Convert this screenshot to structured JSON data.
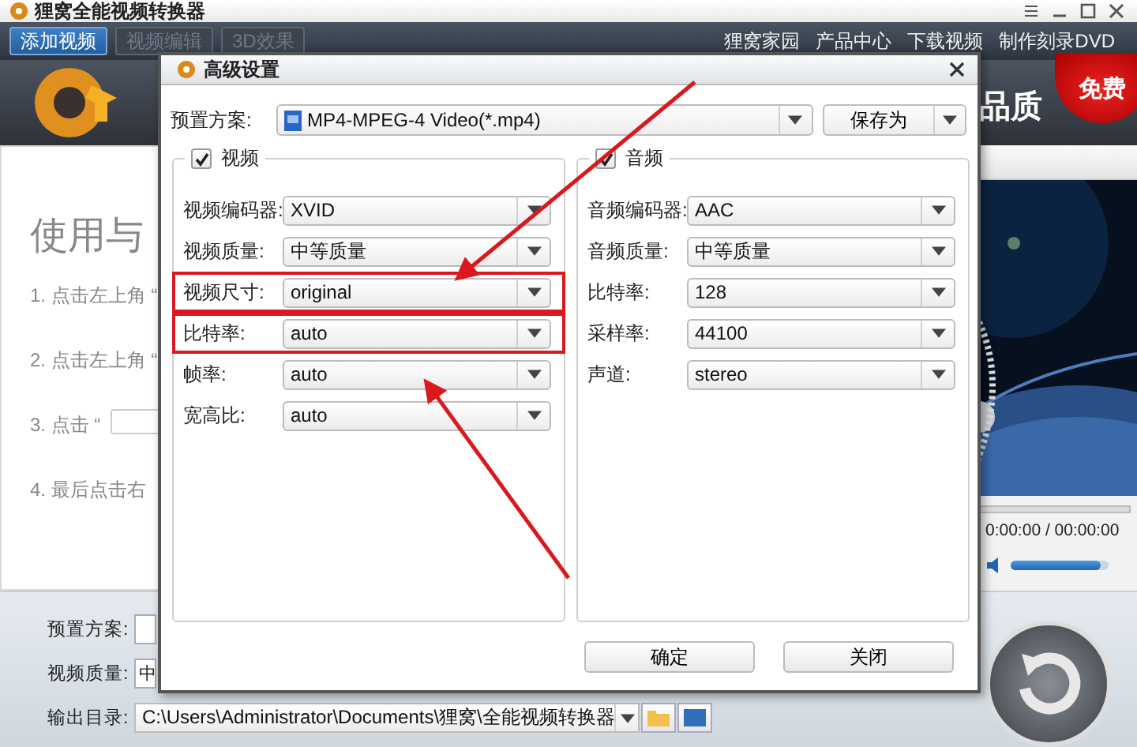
{
  "window": {
    "title": "狸窝全能视频转换器"
  },
  "toolbar": {
    "buttons": [
      {
        "label": "添加视频",
        "disabled": false
      },
      {
        "label": "视频编辑",
        "disabled": true
      },
      {
        "label": "3D效果",
        "disabled": true
      }
    ],
    "links": [
      "狸窝家园",
      "产品中心",
      "下载视频",
      "制作刻录DVD"
    ]
  },
  "banner": {
    "slogan": "品质",
    "badge": "免费"
  },
  "guide": {
    "title": "使用与",
    "steps": [
      "1. 点击左上角 “",
      "2. 点击左上角 “",
      "3. 点击 “",
      "4. 最后点击右"
    ]
  },
  "player": {
    "time": "0:00:00 / 00:00:00",
    "volume": {
      "level": 0.92
    }
  },
  "bottom": {
    "preset_label": "预置方案:",
    "quality_label": "视频质量:",
    "quality_value": "中",
    "output_label": "输出目录:",
    "output_path": "C:\\Users\\Administrator\\Documents\\狸窝\\全能视频转换器"
  },
  "dialog": {
    "title": "高级设置",
    "preset_label": "预置方案:",
    "preset_value": "MP4-MPEG-4 Video(*.mp4)",
    "save_as": "保存为",
    "video": {
      "label": "视频",
      "checked": true,
      "rows": [
        {
          "label": "视频编码器:",
          "value": "XVID",
          "highlighted": false
        },
        {
          "label": "视频质量:",
          "value": "中等质量",
          "highlighted": false
        },
        {
          "label": "视频尺寸:",
          "value": "original",
          "highlighted": true
        },
        {
          "label": "比特率:",
          "value": "auto",
          "highlighted": true
        },
        {
          "label": "帧率:",
          "value": "auto",
          "highlighted": false
        },
        {
          "label": "宽高比:",
          "value": "auto",
          "highlighted": false
        }
      ]
    },
    "audio": {
      "label": "音频",
      "checked": true,
      "rows": [
        {
          "label": "音频编码器:",
          "value": "AAC",
          "highlighted": false
        },
        {
          "label": "音频质量:",
          "value": "中等质量",
          "highlighted": false
        },
        {
          "label": "比特率:",
          "value": "128",
          "highlighted": false
        },
        {
          "label": "采样率:",
          "value": "44100",
          "highlighted": false
        },
        {
          "label": "声道:",
          "value": "stereo",
          "highlighted": false
        }
      ]
    },
    "buttons": [
      "确定",
      "关闭"
    ]
  }
}
